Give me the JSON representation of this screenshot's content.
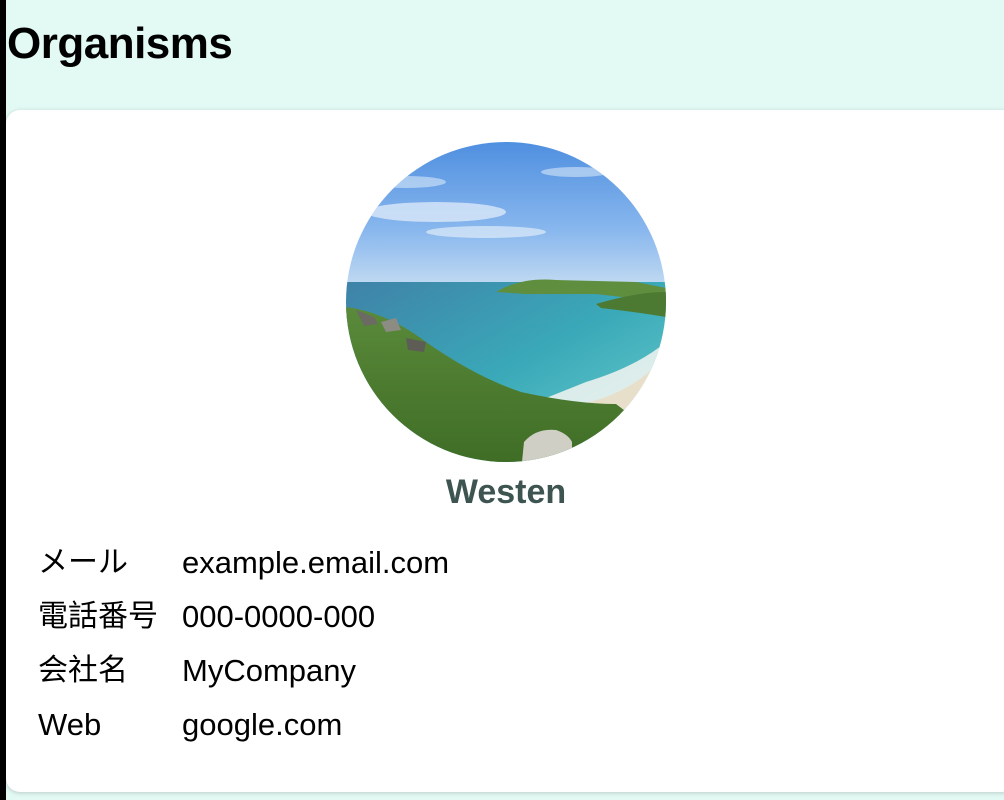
{
  "page": {
    "title": "Organisms",
    "background_color": "#e3f9f3"
  },
  "profile": {
    "image": "landscape-beach-photo",
    "name": "Westen",
    "name_color": "#3d5450",
    "fields": [
      {
        "label": "メール",
        "value": "example.email.com"
      },
      {
        "label": "電話番号",
        "value": "000-0000-000"
      },
      {
        "label": "会社名",
        "value": "MyCompany"
      },
      {
        "label": "Web",
        "value": "google.com"
      }
    ]
  }
}
